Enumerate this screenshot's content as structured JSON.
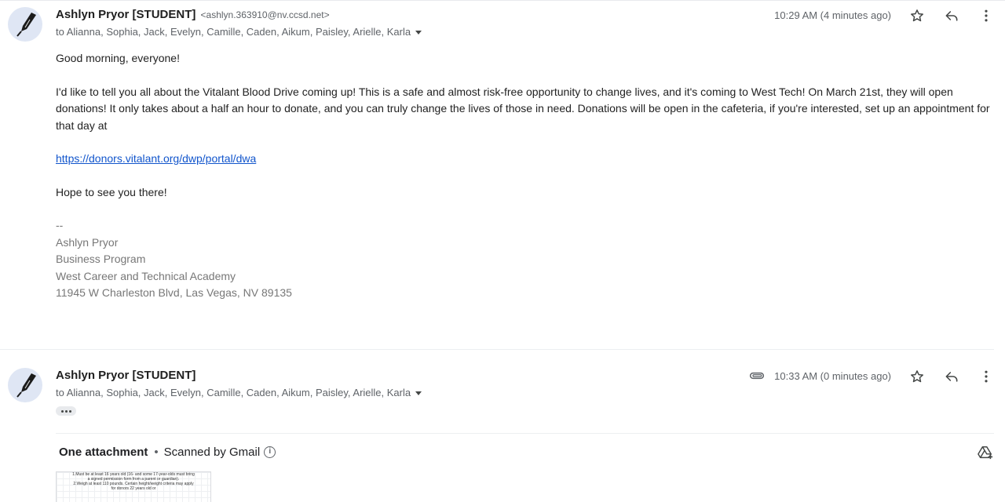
{
  "message1": {
    "sender_name": "Ashlyn Pryor [STUDENT]",
    "sender_email": "<ashlyn.363910@nv.ccsd.net>",
    "recipients": "to Alianna, Sophia, Jack, Evelyn, Camille, Caden, Aikum, Paisley, Arielle, Karla",
    "time": "10:29 AM (4 minutes ago)",
    "greeting": "Good morning, everyone!",
    "paragraph": "I'd like to tell you all about the Vitalant Blood Drive coming up! This is a safe and almost risk-free opportunity to change lives, and it's coming to West Tech! On March 21st, they will open donations! It only takes about a half an hour to donate, and you can truly change the lives of those in need. Donations will be open in the cafeteria, if you're interested, set up an appointment for that day at",
    "link": "https://donors.vitalant.org/dwp/portal/dwa",
    "closing": "Hope to see you there!",
    "signature": {
      "separator": "--",
      "name": "Ashlyn Pryor",
      "program": "Business Program",
      "school": "West Career and Technical Academy",
      "address": "11945 W Charleston Blvd, Las Vegas, NV 89135"
    }
  },
  "message2": {
    "sender_name": "Ashlyn Pryor [STUDENT]",
    "recipients": "to Alianna, Sophia, Jack, Evelyn, Camille, Caden, Aikum, Paisley, Arielle, Karla",
    "time": "10:33 AM (0 minutes ago)",
    "attachments_heading": "One attachment",
    "scanned_label": "Scanned by Gmail",
    "attachment_preview_lines": [
      "1.Must be at least 16 years old (16- and some 17-year-olds must bring a signed permission form from a parent or guardian).",
      "2.Weigh at least 110 pounds. Certain height/weight criteria may apply for donors 22 years old or"
    ]
  },
  "icons": {
    "star": "star-icon",
    "reply": "reply-icon",
    "more": "more-vert-icon",
    "attachment": "paperclip-icon",
    "drive": "add-to-drive-icon",
    "info": "info-icon"
  },
  "colors": {
    "link": "#1155cc",
    "secondary_text": "#5f6368",
    "signature_text": "#777777"
  }
}
